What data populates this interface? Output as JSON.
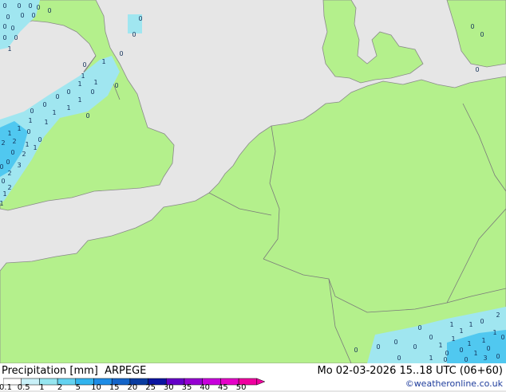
{
  "title": "Precipitation [mm]  ARPEGE",
  "datetime": "Mo 02-03-2026 15..18 UTC (06+60)",
  "credit": "weatheronline.co.uk",
  "legend": {
    "ticks": [
      "0.1",
      "0.5",
      "1",
      "2",
      "5",
      "10",
      "15",
      "20",
      "25",
      "30",
      "35",
      "40",
      "45",
      "50"
    ],
    "colors": [
      "#ffffff",
      "#c8f0f8",
      "#96e6f0",
      "#64d2f0",
      "#32b4ee",
      "#1e8ce6",
      "#1464c8",
      "#0a3ca0",
      "#0a14a0",
      "#6400c8",
      "#9600d2",
      "#c800dc",
      "#e600c8",
      "#f000a0"
    ]
  },
  "map": {
    "land_color": "#b4f08c",
    "sea_color": "#e6e6e6",
    "rain_color": "#a0e6f0",
    "rain_dark_color": "#50c8f0",
    "label_color": "#14325a"
  },
  "rain_labels": [
    "0",
    "0",
    "0",
    "0",
    "0",
    "0",
    "0",
    "0",
    "0",
    "0",
    "0",
    "0",
    "1",
    "0",
    "1",
    "0",
    "1",
    "1",
    "1",
    "0",
    "0",
    "0",
    "1",
    "0",
    "1",
    "0",
    "1",
    "0",
    "1",
    "1",
    "1",
    "1",
    "0",
    "0",
    "2",
    "1",
    "2",
    "1",
    "0",
    "2",
    "0",
    "3",
    "0",
    "2",
    "0",
    "2",
    "1",
    "1",
    "0",
    "0",
    "0",
    "0",
    "0",
    "0",
    "0",
    "0",
    "0",
    "0",
    "0",
    "1",
    "0",
    "1",
    "0",
    "1",
    "1",
    "1",
    "0",
    "1",
    "1",
    "1",
    "0",
    "2",
    "0",
    "1",
    "3",
    "0",
    "0",
    "1",
    "0",
    "0",
    "0"
  ]
}
